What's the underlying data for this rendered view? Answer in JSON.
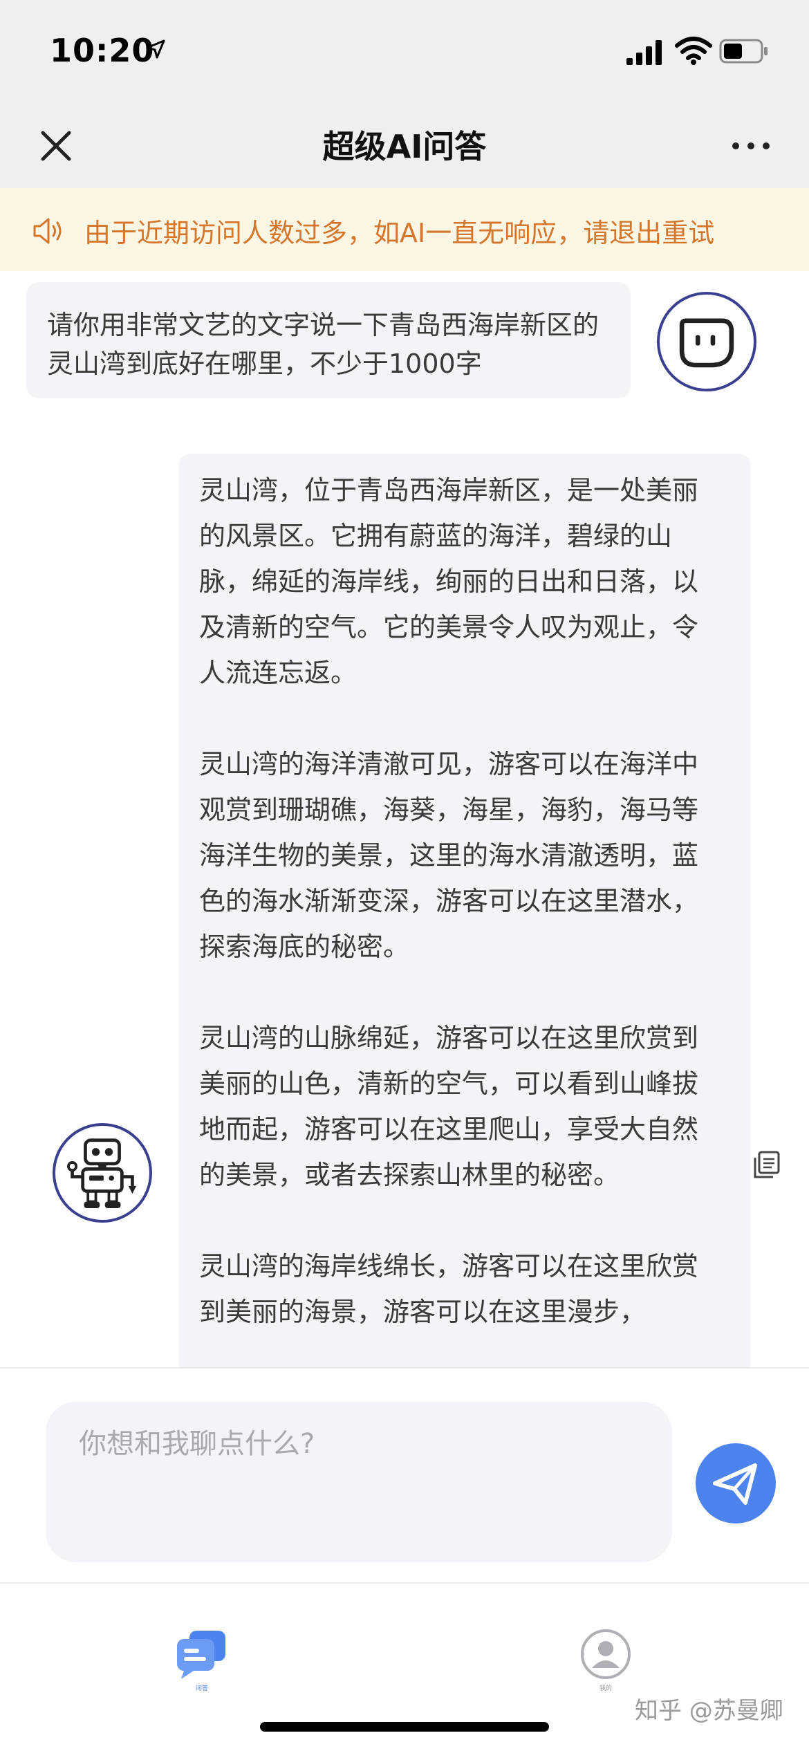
{
  "status_bar": {
    "time": "10:20"
  },
  "header": {
    "title": "超级AI问答"
  },
  "notice": {
    "text": "由于近期访问人数过多，如AI一直无响应，请退出重试"
  },
  "chat": {
    "user_message": "请你用非常文艺的文字说一下青岛西海岸新区的灵山湾到底好在哪里，不少于1000字",
    "ai_paragraphs": [
      "灵山湾，位于青岛西海岸新区，是一处美丽的风景区。它拥有蔚蓝的海洋，碧绿的山脉，绵延的海岸线，绚丽的日出和日落，以及清新的空气。它的美景令人叹为观止，令人流连忘返。",
      "灵山湾的海洋清澈可见，游客可以在海洋中观赏到珊瑚礁，海葵，海星，海豹，海马等海洋生物的美景，这里的海水清澈透明，蓝色的海水渐渐变深，游客可以在这里潜水，探索海底的秘密。",
      "灵山湾的山脉绵延，游客可以在这里欣赏到美丽的山色，清新的空气，可以看到山峰拔地而起，游客可以在这里爬山，享受大自然的美景，或者去探索山林里的秘密。",
      "灵山湾的海岸线绵长，游客可以在这里欣赏到美丽的海景，游客可以在这里漫步，"
    ]
  },
  "input": {
    "placeholder": "你想和我聊点什么?"
  },
  "tabs": {
    "chat_label": "问答",
    "me_label": "我的"
  },
  "watermark": "知乎 @苏曼卿",
  "colors": {
    "accent": "#4c83ec",
    "notice_text": "#d4762b",
    "notice_bg": "#fcf6e4",
    "avatar_border": "#3a3f8f"
  }
}
